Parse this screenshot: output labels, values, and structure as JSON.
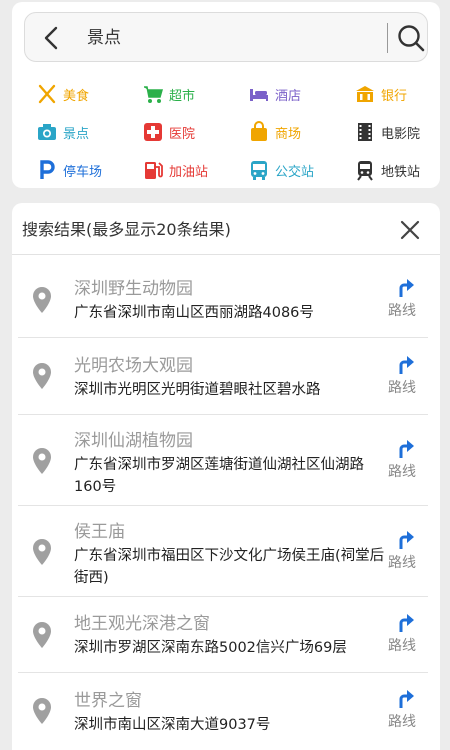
{
  "search": {
    "query": "景点"
  },
  "categories": [
    {
      "label": "美食",
      "icon": "food-icon",
      "color": "#f0a500"
    },
    {
      "label": "超市",
      "icon": "cart-icon",
      "color": "#2bb04a"
    },
    {
      "label": "酒店",
      "icon": "bed-icon",
      "color": "#7b61c9"
    },
    {
      "label": "银行",
      "icon": "bank-icon",
      "color": "#f0a500"
    },
    {
      "label": "景点",
      "icon": "camera-icon",
      "color": "#2aa5c7"
    },
    {
      "label": "医院",
      "icon": "hospital-icon",
      "color": "#e53935"
    },
    {
      "label": "商场",
      "icon": "shopping-bag-icon",
      "color": "#f0a500"
    },
    {
      "label": "电影院",
      "icon": "film-icon",
      "color": "#333333"
    },
    {
      "label": "停车场",
      "icon": "parking-icon",
      "color": "#1e6fd9"
    },
    {
      "label": "加油站",
      "icon": "gas-station-icon",
      "color": "#e53935"
    },
    {
      "label": "公交站",
      "icon": "bus-icon",
      "color": "#2aa5c7"
    },
    {
      "label": "地铁站",
      "icon": "subway-icon",
      "color": "#333333"
    }
  ],
  "results": {
    "title": "搜索结果(最多显示20条结果)",
    "route_label": "路线",
    "items": [
      {
        "name": "深圳野生动物园",
        "address": "广东省深圳市南山区西丽湖路4086号"
      },
      {
        "name": "光明农场大观园",
        "address": "深圳市光明区光明街道碧眼社区碧水路"
      },
      {
        "name": "深圳仙湖植物园",
        "address": "广东省深圳市罗湖区莲塘街道仙湖社区仙湖路160号"
      },
      {
        "name": "侯王庙",
        "address": "广东省深圳市福田区下沙文化广场侯王庙(祠堂后街西)"
      },
      {
        "name": "地王观光深港之窗",
        "address": "深圳市罗湖区深南东路5002信兴广场69层"
      },
      {
        "name": "世界之窗",
        "address": "深圳市南山区深南大道9037号"
      }
    ]
  },
  "colors": {
    "route_blue": "#1e6fd9",
    "pin_gray": "#a0a0a0"
  }
}
